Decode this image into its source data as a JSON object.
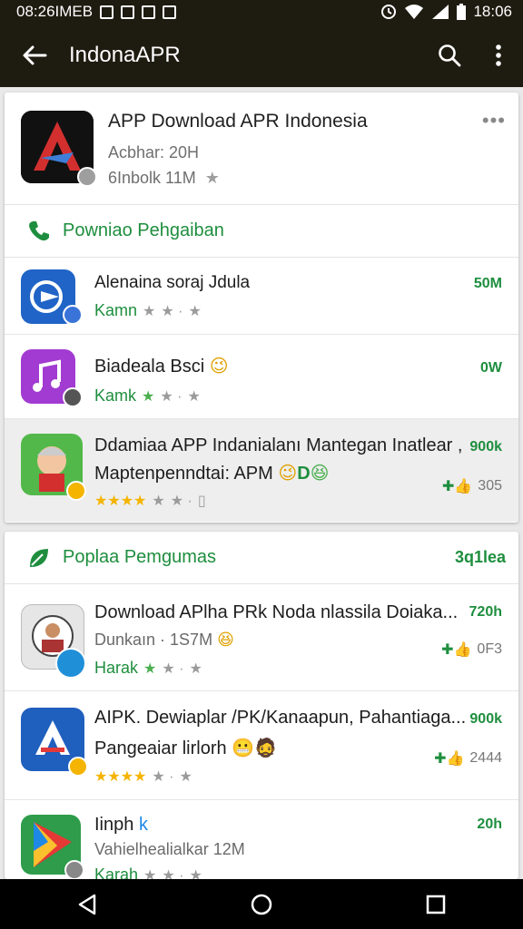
{
  "status": {
    "left_text": "08:26IMEB",
    "time": "18:06"
  },
  "appbar": {
    "title": "IndonaAPR"
  },
  "hero": {
    "title": "APP Download APR Indonesia",
    "line1": "Acbhar: 20H",
    "line2": "6Inbolk 11M"
  },
  "section1": {
    "title": "Powniao Pehgaiban",
    "rows": [
      {
        "name": "Alenaina soraj Jdula",
        "stars_label": "Kamn",
        "size": "50M"
      },
      {
        "name": "Biadeala Bsci",
        "stars_label": "Kamk",
        "size": "0W"
      },
      {
        "name": "Ddamiaa APP Indanialanı Mantegan Inatlear ,",
        "sub": "Maptenpenndtai: APM",
        "size": "900k",
        "count": "305"
      }
    ]
  },
  "section2": {
    "title": "Poplaa Pemgumas",
    "right": "3q1lea",
    "rows": [
      {
        "name": "Download APlha PRk Noda nlassila Doiaka...",
        "sub": "Dunkaın · 1S7M",
        "stars_label": "Harak",
        "size": "720h",
        "count": "0F3"
      },
      {
        "name": "AIPK. Dewiaplar /PK/Kanaapun, Pahantiaga...",
        "sub": "Pangeaiar lirlorh",
        "size": "900k",
        "count": "2444"
      },
      {
        "name": "Iinph",
        "sub": "Vahielhealialkar 12M",
        "stars_label": "Karah",
        "size": "20h"
      }
    ]
  },
  "colors": {
    "accent": "#1e8e3e",
    "bar": "#1e1b10",
    "star": "#f4b400"
  }
}
